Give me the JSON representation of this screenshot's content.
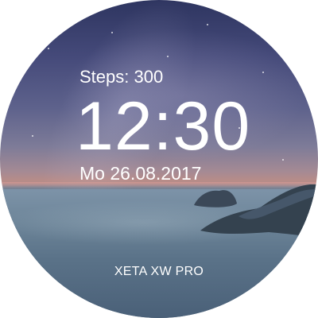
{
  "watch": {
    "steps": "Steps: 300",
    "time": "12:30",
    "date": "Mo 26.08.2017",
    "brand": "XETA XW PRO"
  },
  "background": {
    "scene": "night-sky-seascape",
    "sky_color": "#454a7a",
    "horizon_color": "#b98c88",
    "sea_color": "#5a7288",
    "text_color": "#ffffff"
  }
}
